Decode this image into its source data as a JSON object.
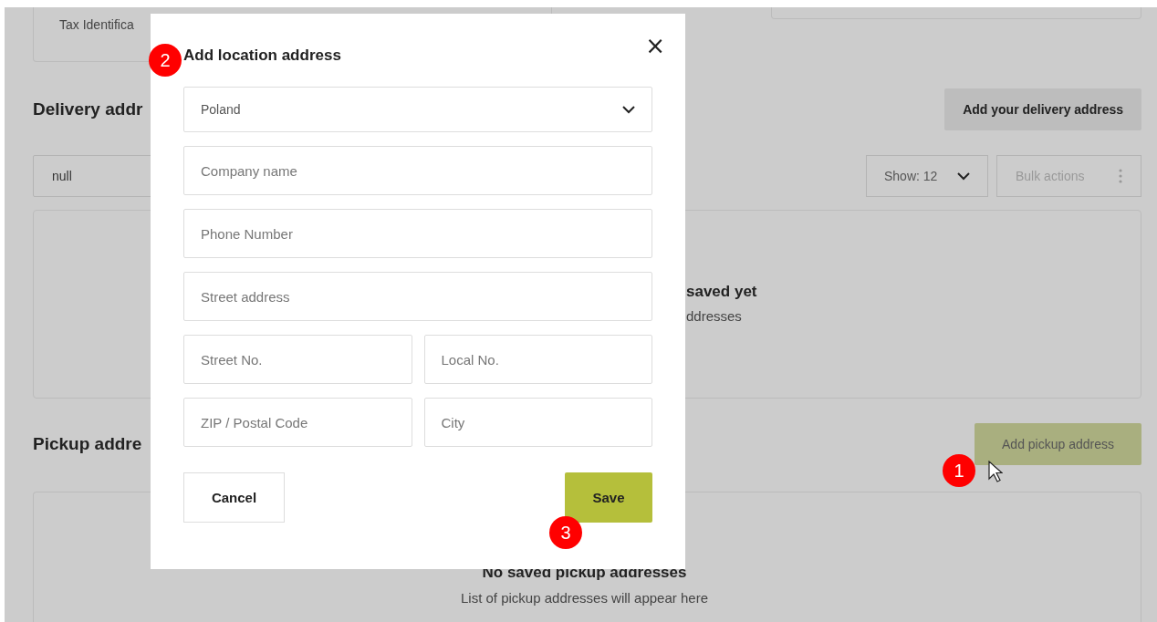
{
  "page": {
    "tax_card": {
      "text": "Tax Identifica"
    },
    "delivery": {
      "title": "Delivery addr",
      "add_button": "Add your delivery address",
      "filter_value": "null",
      "show": "Show: 12",
      "bulk_actions": {
        "label": "Bulk actions",
        "disabled": true
      },
      "empty_title": "saved yet",
      "empty_text": "ddresses"
    },
    "pickup": {
      "title": "Pickup addre",
      "add_button": "Add pickup address",
      "empty_title": "No saved pickup addresses",
      "empty_text": "List of pickup addresses will appear here"
    }
  },
  "modal": {
    "title": "Add location address",
    "close": "×",
    "fields": [
      {
        "kind": "select",
        "value": "Poland"
      },
      {
        "kind": "text",
        "placeholder": "Company name"
      },
      {
        "kind": "text",
        "placeholder": "Phone Number"
      },
      {
        "kind": "text",
        "placeholder": "Street address"
      },
      {
        "kind": "pair",
        "items": [
          {
            "placeholder": "Street No."
          },
          {
            "placeholder": "Local No."
          }
        ]
      },
      {
        "kind": "pair",
        "items": [
          {
            "placeholder": "ZIP / Postal Code"
          },
          {
            "placeholder": "City"
          }
        ]
      }
    ],
    "cancel": "Cancel",
    "save": "Save"
  },
  "annotations": [
    {
      "label": "1"
    },
    {
      "label": "2"
    },
    {
      "label": "3"
    }
  ]
}
